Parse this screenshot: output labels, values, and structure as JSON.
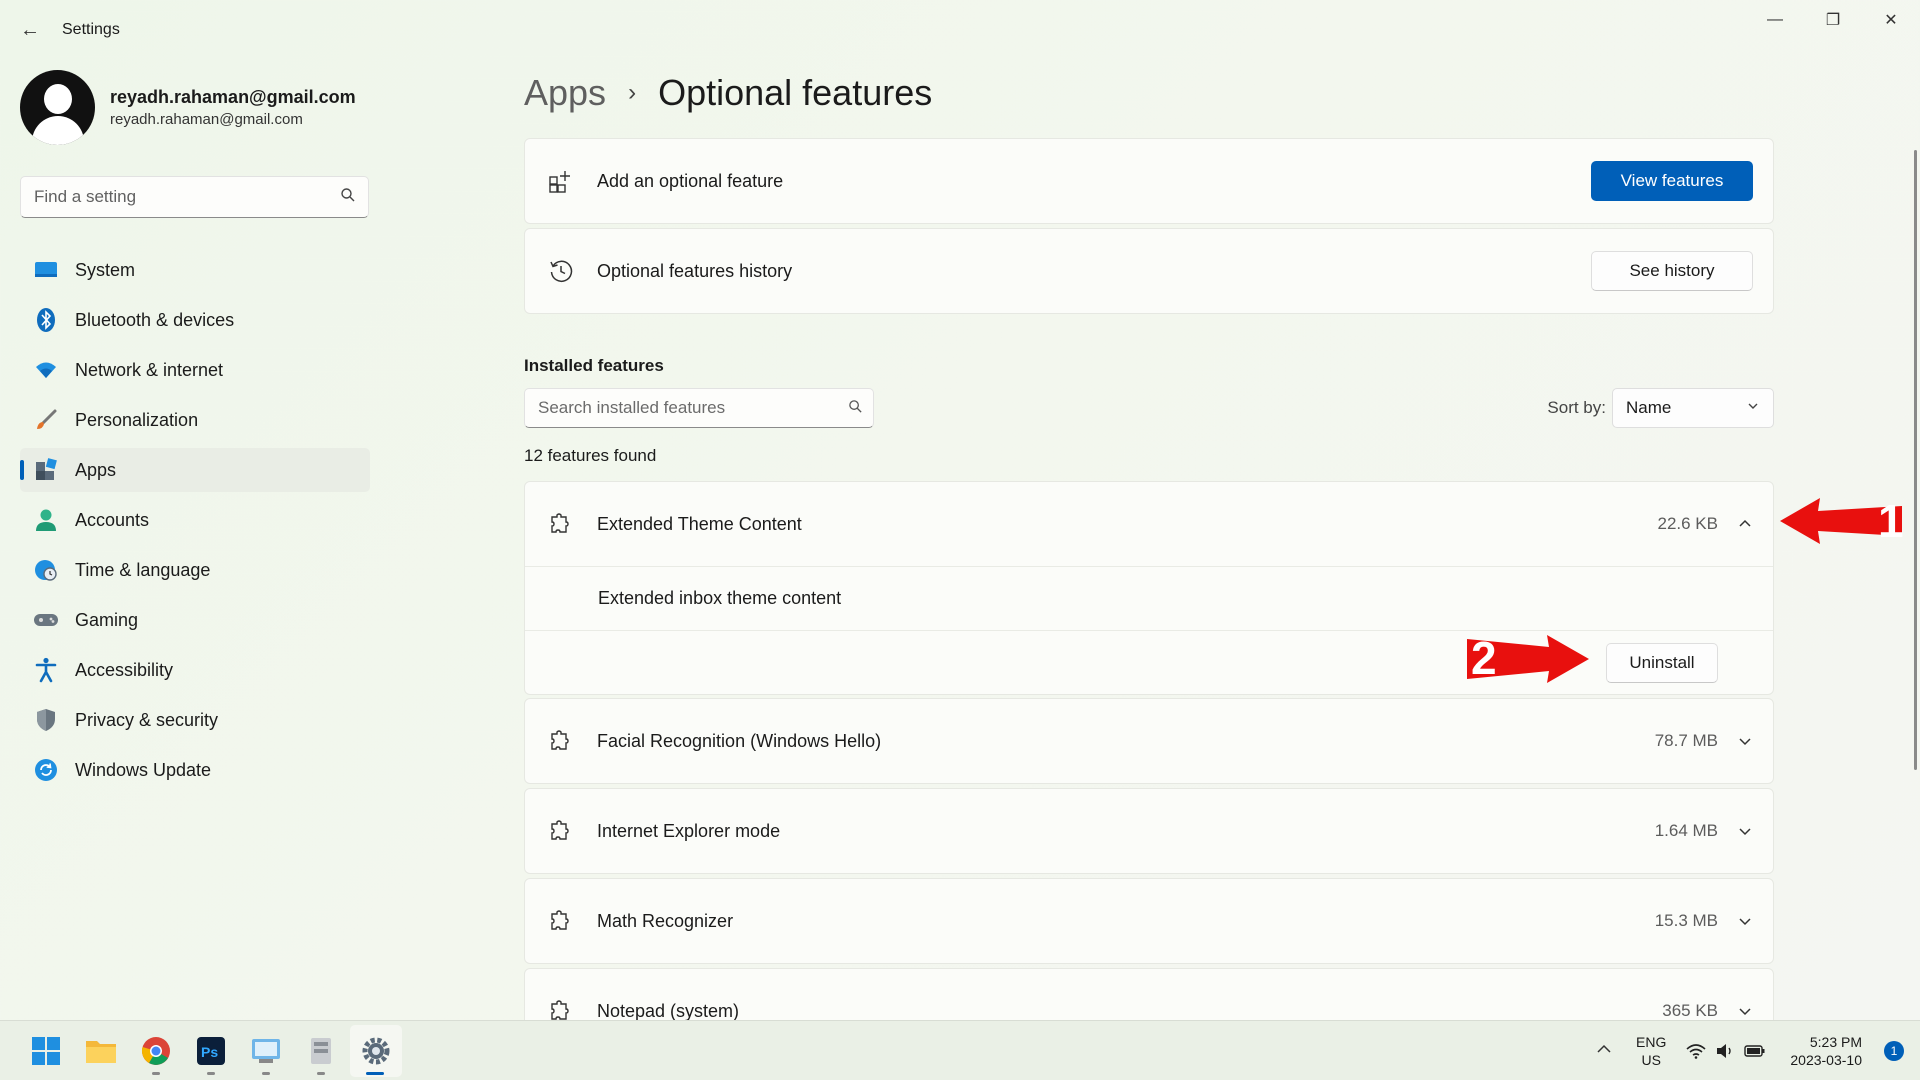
{
  "window": {
    "title": "Settings",
    "back_icon": "←",
    "minimize_icon": "—",
    "restore_icon": "❐",
    "close_icon": "✕"
  },
  "profile": {
    "name": "reyadh.rahaman@gmail.com",
    "email": "reyadh.rahaman@gmail.com"
  },
  "sidebar": {
    "search_placeholder": "Find a setting",
    "items": [
      {
        "label": "System",
        "icon": "system-icon"
      },
      {
        "label": "Bluetooth & devices",
        "icon": "bluetooth-icon"
      },
      {
        "label": "Network & internet",
        "icon": "wifi-icon"
      },
      {
        "label": "Personalization",
        "icon": "brush-icon"
      },
      {
        "label": "Apps",
        "icon": "apps-icon",
        "active": true
      },
      {
        "label": "Accounts",
        "icon": "person-icon"
      },
      {
        "label": "Time & language",
        "icon": "globe-clock-icon"
      },
      {
        "label": "Gaming",
        "icon": "gamepad-icon"
      },
      {
        "label": "Accessibility",
        "icon": "accessibility-icon"
      },
      {
        "label": "Privacy & security",
        "icon": "shield-icon"
      },
      {
        "label": "Windows Update",
        "icon": "update-icon"
      }
    ]
  },
  "main": {
    "breadcrumb_parent": "Apps",
    "breadcrumb_sep": "›",
    "breadcrumb_current": "Optional features",
    "add_feature": {
      "label": "Add an optional feature",
      "button": "View features"
    },
    "history": {
      "label": "Optional features history",
      "button": "See history"
    },
    "installed_title": "Installed features",
    "installed_search_placeholder": "Search installed features",
    "sort_label": "Sort by:",
    "sort_value": "Name",
    "count_text": "12 features found",
    "features": [
      {
        "name": "Extended Theme Content",
        "size": "22.6 KB",
        "expanded": true,
        "description": "Extended inbox theme content",
        "action": "Uninstall"
      },
      {
        "name": "Facial Recognition (Windows Hello)",
        "size": "78.7 MB"
      },
      {
        "name": "Internet Explorer mode",
        "size": "1.64 MB"
      },
      {
        "name": "Math Recognizer",
        "size": "15.3 MB"
      },
      {
        "name": "Notepad (system)",
        "size": "365 KB"
      }
    ]
  },
  "annotations": {
    "arrow1_number": "1",
    "arrow2_number": "2",
    "color": "#e8100e"
  },
  "taskbar": {
    "lang_top": "ENG",
    "lang_bottom": "US",
    "time": "5:23 PM",
    "date": "2023-03-10",
    "notification_count": "1",
    "tray_chevron": "^"
  },
  "colors": {
    "accent": "#005fb8"
  }
}
